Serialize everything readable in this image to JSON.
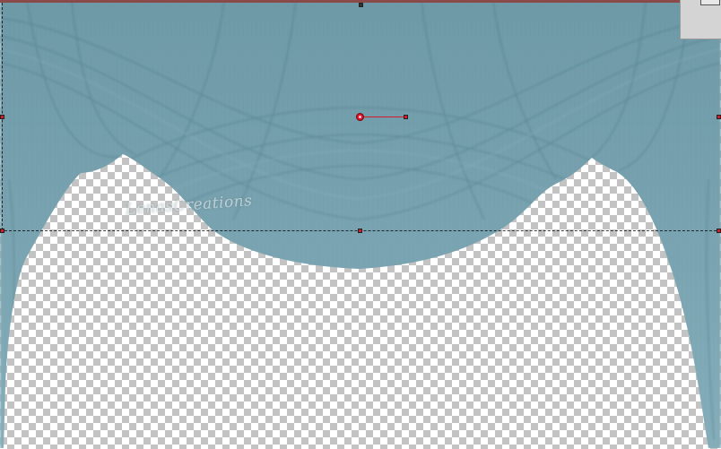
{
  "canvas": {
    "background": "transparency-checkerboard",
    "layer": "curtain-drape",
    "drape_color": "#7aa4b1",
    "fold_color": "#3f7081",
    "watermark_text": "LenasCreations"
  },
  "selection": {
    "handle_color": "#d21c2c",
    "marquee_style": "dashed"
  },
  "panel": {
    "icon": "collapse-icon"
  }
}
